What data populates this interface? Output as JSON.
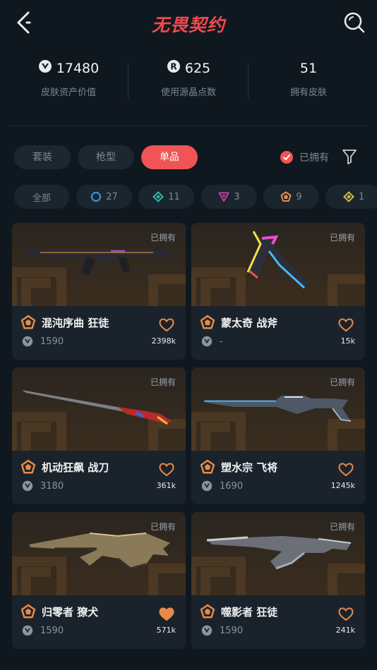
{
  "header": {
    "title": "无畏契约"
  },
  "stats": [
    {
      "value": "17480",
      "label": "皮肤资产价值",
      "icon": "vp-icon"
    },
    {
      "value": "625",
      "label": "使用源晶点数",
      "icon": "radianite-icon"
    },
    {
      "value": "51",
      "label": "拥有皮肤"
    }
  ],
  "tabs": [
    {
      "label": "套装"
    },
    {
      "label": "枪型"
    },
    {
      "label": "单品",
      "active": true
    }
  ],
  "owned_toggle": {
    "label": "已拥有",
    "checked": true
  },
  "chips": [
    {
      "label": "全部"
    },
    {
      "count": "27",
      "icon": "circle-tier-icon",
      "color": "#3a8fd8"
    },
    {
      "count": "11",
      "icon": "diamond-tier-icon",
      "color": "#2fb7a5"
    },
    {
      "count": "3",
      "icon": "triangle-tier-icon",
      "color": "#c4419a"
    },
    {
      "count": "9",
      "icon": "pentagon-tier-icon",
      "color": "#e58b4a"
    },
    {
      "count": "1",
      "icon": "diamond-tier-icon",
      "color": "#d8b84a"
    }
  ],
  "cards": [
    {
      "owned": "已拥有",
      "name": "混沌序曲 狂徒",
      "price": "1590",
      "likes": "2398k",
      "liked": false
    },
    {
      "owned": "已拥有",
      "name": "蒙太奇 战斧",
      "price": "-",
      "likes": "15k",
      "liked": false
    },
    {
      "owned": "已拥有",
      "name": "机动狂飙 战刀",
      "price": "3180",
      "likes": "361k",
      "liked": false
    },
    {
      "owned": "已拥有",
      "name": "塑水宗 飞将",
      "price": "1690",
      "likes": "1245k",
      "liked": false
    },
    {
      "owned": "已拥有",
      "name": "归零者 獠犬",
      "price": "1590",
      "likes": "571k",
      "liked": true
    },
    {
      "owned": "已拥有",
      "name": "噬影者 狂徒",
      "price": "1590",
      "likes": "241k",
      "liked": false
    }
  ],
  "colors": {
    "accent": "#f05454",
    "tier": "#e58b4a",
    "bg": "#10181f"
  }
}
